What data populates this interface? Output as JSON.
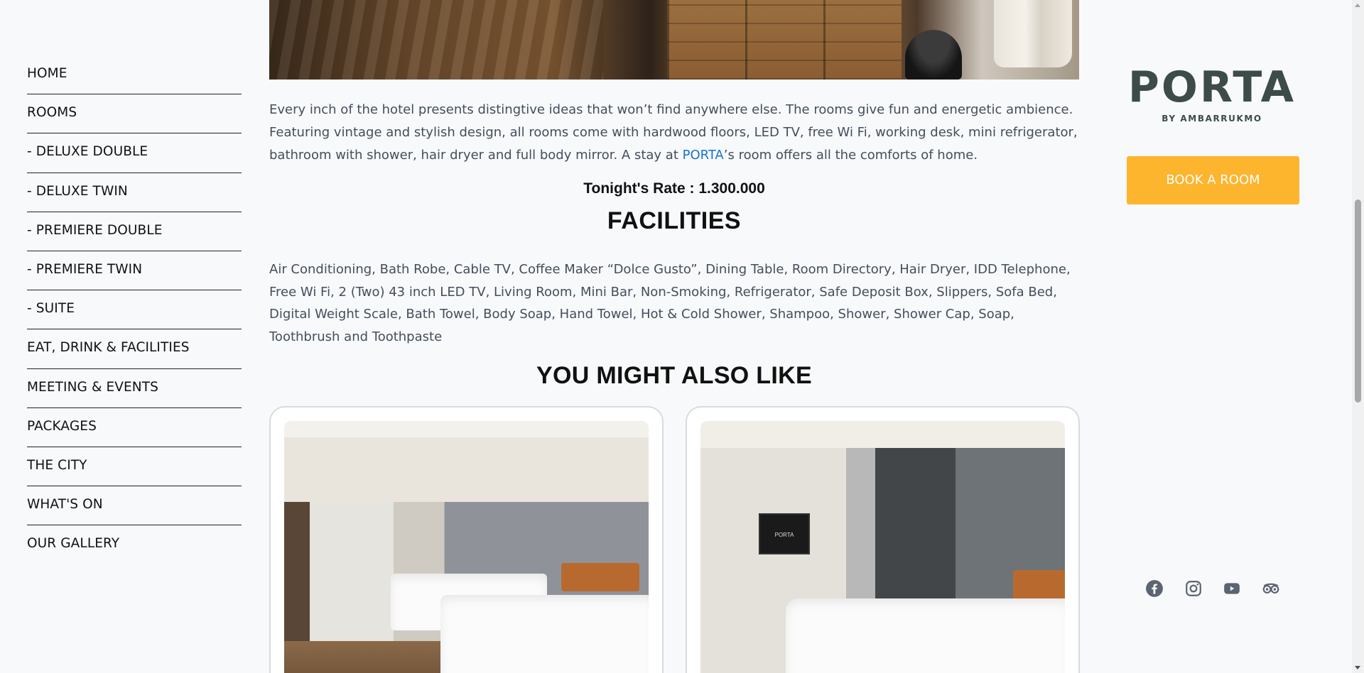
{
  "nav": {
    "items": [
      {
        "label": "HOME"
      },
      {
        "label": "ROOMS"
      },
      {
        "label": "- DELUXE DOUBLE"
      },
      {
        "label": "- DELUXE TWIN"
      },
      {
        "label": "- PREMIERE DOUBLE"
      },
      {
        "label": "- PREMIERE TWIN"
      },
      {
        "label": "- SUITE"
      },
      {
        "label": "EAT, DRINK & FACILITIES"
      },
      {
        "label": "MEETING & EVENTS"
      },
      {
        "label": "PACKAGES"
      },
      {
        "label": "THE CITY"
      },
      {
        "label": "WHAT'S ON"
      },
      {
        "label": "OUR GALLERY"
      }
    ]
  },
  "content": {
    "intro_before": "Every inch of the hotel presents distingtive ideas that won’t find anywhere else. The rooms give fun and energetic ambience. Featuring vintage and stylish design, all rooms come with hardwood floors, LED TV, free Wi Fi, working desk, mini refrigerator, bathroom with shower, hair dryer and full body mirror. A stay at ",
    "intro_link": "PORTA",
    "intro_after": "’s room offers all the comforts of home.",
    "rate": "Tonight's Rate : 1.300.000",
    "facilities_heading": "FACILITIES",
    "facilities_text": "Air Conditioning, Bath Robe, Cable TV, Coffee Maker “Dolce Gusto”, Dining Table, Room Directory, Hair Dryer, IDD Telephone, Free Wi Fi, 2 (Two) 43 inch LED TV, Living Room, Mini Bar, Non-Smoking, Refrigerator, Safe Deposit Box, Slippers, Sofa Bed, Digital Weight Scale, Bath Towel, Body Soap, Hand Towel, Hot & Cold Shower, Shampoo, Shower, Shower Cap, Soap, Toothbrush and Toothpaste",
    "also_heading": "YOU MIGHT ALSO LIKE",
    "card_tv_text": "PORTA"
  },
  "brand": {
    "logo_word": "PORTA",
    "logo_sub": "BY AMBARRUKMO",
    "book_label": "BOOK A ROOM",
    "accent_color": "#fdb52e",
    "link_color": "#1a73c9"
  },
  "social": [
    "facebook-icon",
    "instagram-icon",
    "youtube-icon",
    "tripadvisor-icon"
  ]
}
